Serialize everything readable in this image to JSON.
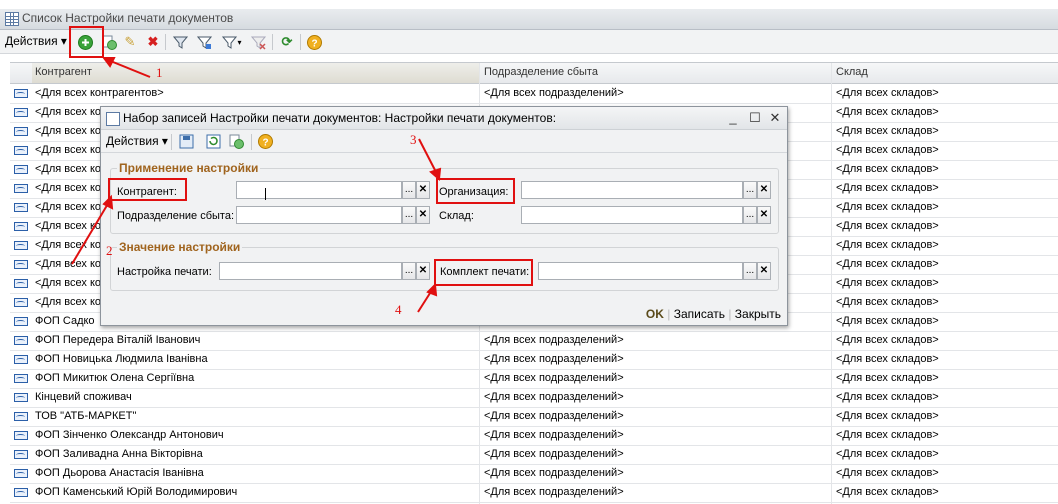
{
  "window": {
    "title": "Список  Настройки печати документов"
  },
  "toolbar": {
    "actions_label": "Действия"
  },
  "table": {
    "columns": [
      "Контрагент",
      "Подразделение сбыта",
      "Склад"
    ],
    "rows": [
      [
        "<Для всех контрагентов>",
        "<Для всех подразделений>",
        "<Для всех складов>"
      ],
      [
        "<Для всех ко",
        "",
        "<Для всех складов>"
      ],
      [
        "<Для всех ко",
        "",
        "<Для всех складов>"
      ],
      [
        "<Для всех ко",
        "",
        "<Для всех складов>"
      ],
      [
        "<Для всех ко",
        "",
        "<Для всех складов>"
      ],
      [
        "<Для всех ко",
        "",
        "<Для всех складов>"
      ],
      [
        "<Для всех ко",
        "",
        "<Для всех складов>"
      ],
      [
        "<Для всех ко",
        "",
        "<Для всех складов>"
      ],
      [
        "<Для всех ко",
        "",
        "<Для всех складов>"
      ],
      [
        "<Для всех ко",
        "",
        "<Для всех складов>"
      ],
      [
        "<Для всех ко",
        "",
        "<Для всех складов>"
      ],
      [
        "<Для всех ко",
        "",
        "<Для всех складов>"
      ],
      [
        "ФОП Садко",
        "",
        "<Для всех складов>"
      ],
      [
        "ФОП Передера Віталій Іванович",
        "<Для всех подразделений>",
        "<Для всех складов>"
      ],
      [
        "ФОП Новицька Людмила Іванівна",
        "<Для всех подразделений>",
        "<Для всех складов>"
      ],
      [
        "ФОП Микитюк Олена Сергіївна",
        "<Для всех подразделений>",
        "<Для всех складов>"
      ],
      [
        "Кінцевий споживач",
        "<Для всех подразделений>",
        "<Для всех складов>"
      ],
      [
        "ТОВ \"АТБ-МАРКЕТ\"",
        "<Для всех подразделений>",
        "<Для всех складов>"
      ],
      [
        "ФОП Зінченко Олександр Антонович",
        "<Для всех подразделений>",
        "<Для всех складов>"
      ],
      [
        "ФОП Заливадна Анна Вікторівна",
        "<Для всех подразделений>",
        "<Для всех складов>"
      ],
      [
        "ФОП Дьорова Анастасія Іванівна",
        "<Для всех подразделений>",
        "<Для всех складов>"
      ],
      [
        "ФОП Каменський Юрій Володимирович",
        "<Для всех подразделений>",
        "<Для всех складов>"
      ]
    ]
  },
  "dialog": {
    "title": "Набор записей Настройки печати документов: Настройки печати документов:",
    "actions_label": "Действия",
    "group1_title": "Применение настройки",
    "group2_title": "Значение настройки",
    "kontragent_label": "Контрагент:",
    "podrazdelenie_label": "Подразделение сбыта:",
    "organizaciya_label": "Организация:",
    "sklad_label": "Склад:",
    "nastroika_label": "Настройка печати:",
    "komplekt_label": "Комплект печати:",
    "ok_label": "OK",
    "save_label": "Записать",
    "close_label": "Закрыть"
  },
  "annotations": [
    "1",
    "2",
    "3",
    "4"
  ],
  "colors": {
    "annotation": "#e01010",
    "group_title": "#a0641e"
  }
}
